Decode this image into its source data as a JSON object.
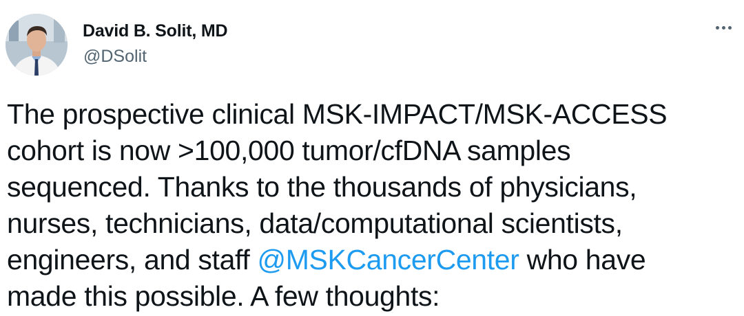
{
  "author": {
    "display_name": "David B. Solit, MD",
    "handle": "@DSolit"
  },
  "icons": {
    "more": "more-horizontal-icon",
    "avatar": "profile-photo"
  },
  "colors": {
    "text": "#0f1419",
    "secondary": "#536471",
    "link": "#1d9bf0"
  },
  "tweet": {
    "line1": "The prospective clinical MSK-IMPACT/MSK-ACCESS",
    "line2": "cohort is now >100,000 tumor/cfDNA samples",
    "line3": "sequenced. Thanks to the thousands of physicians,",
    "line4": "nurses, technicians, data/computational scientists,",
    "line5_pre": "engineers, and staff ",
    "line5_mention": "@MSKCancerCenter",
    "line5_post": " who have",
    "line6": "made this possible. A few thoughts:"
  }
}
